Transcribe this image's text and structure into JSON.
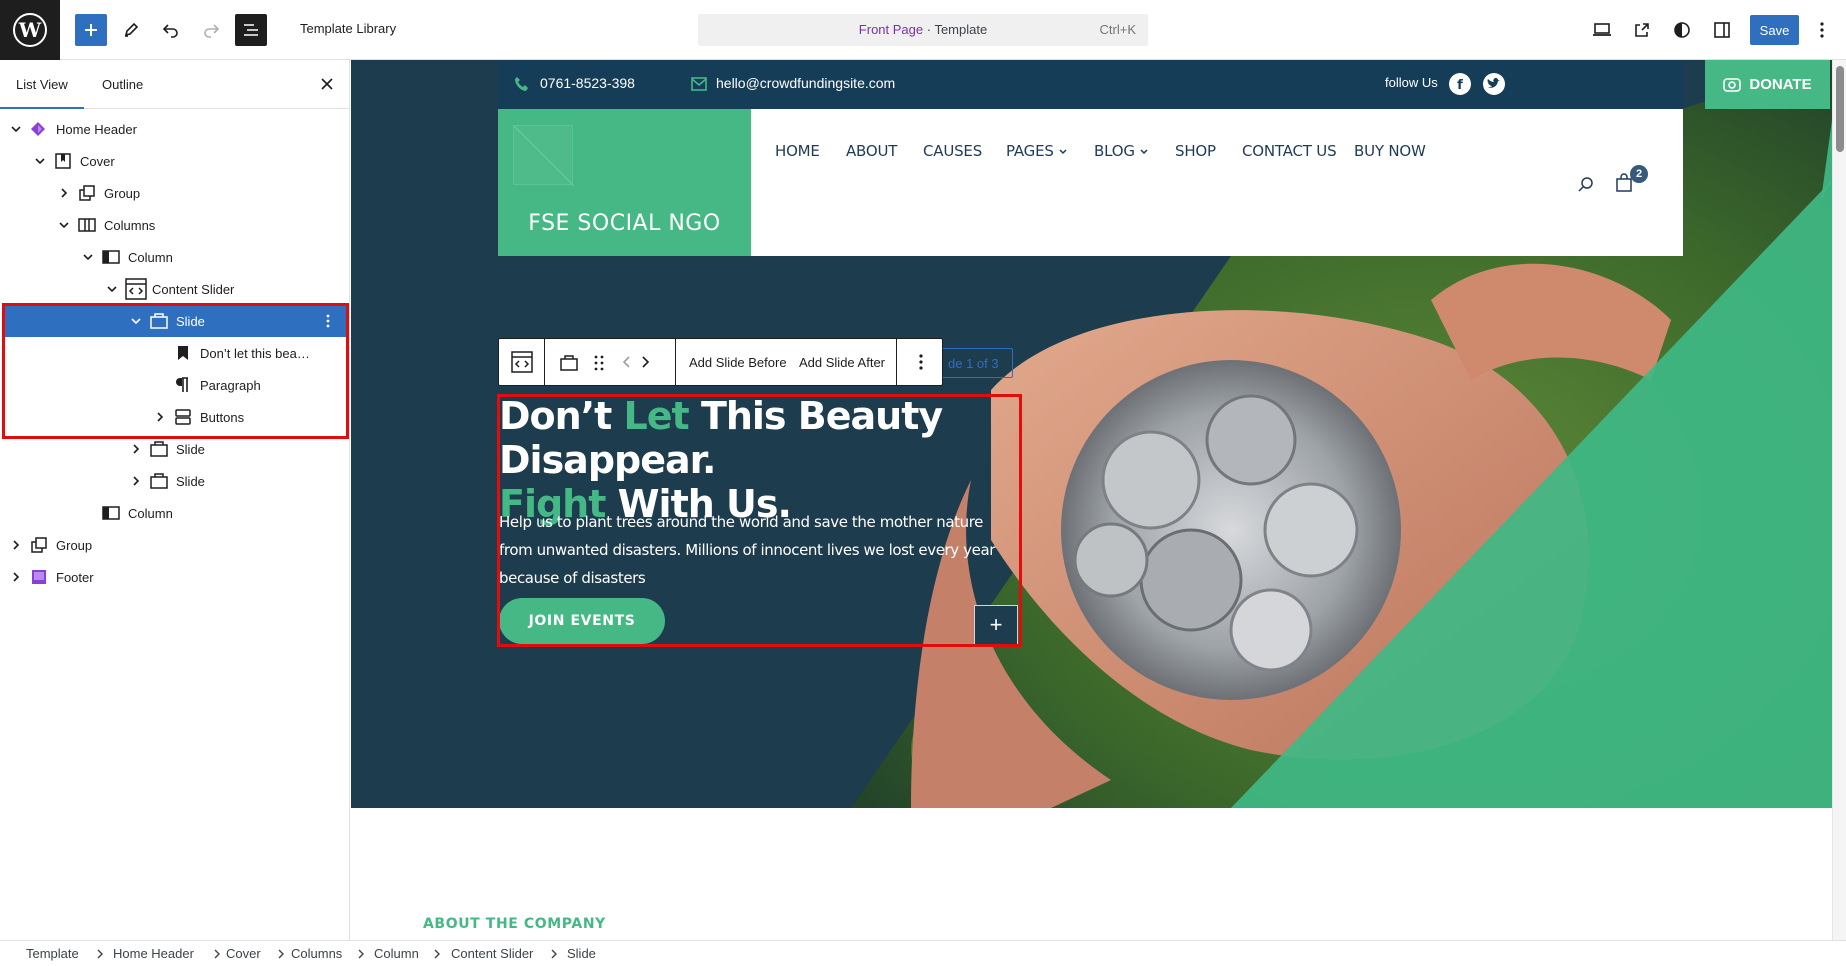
{
  "topbar": {
    "title": "Template Library",
    "command": {
      "page": "Front Page",
      "separator": " · ",
      "type": "Template",
      "shortcut": "Ctrl+K"
    },
    "save_label": "Save"
  },
  "panel": {
    "tabs": [
      "List View",
      "Outline"
    ],
    "tree": [
      {
        "label": "Home Header"
      },
      {
        "label": "Cover"
      },
      {
        "label": "Group"
      },
      {
        "label": "Columns"
      },
      {
        "label": "Column"
      },
      {
        "label": "Content Slider"
      },
      {
        "label": "Slide"
      },
      {
        "label": "Don’t let this bea…"
      },
      {
        "label": "Paragraph"
      },
      {
        "label": "Buttons"
      },
      {
        "label": "Slide"
      },
      {
        "label": "Slide"
      },
      {
        "label": "Column"
      },
      {
        "label": "Group"
      },
      {
        "label": "Footer"
      }
    ]
  },
  "site": {
    "phone": "0761-8523-398",
    "email": "hello@crowdfundingsite.com",
    "follow": "follow Us",
    "donate": "DONATE",
    "logo_name": "FSE SOCIAL NGO",
    "nav": [
      "HOME",
      "ABOUT",
      "CAUSES",
      "PAGES",
      "BLOG",
      "SHOP",
      "CONTACT US",
      "BUY NOW"
    ],
    "cart_count": "2"
  },
  "block_toolbar": {
    "add_before": "Add Slide Before",
    "add_after": "Add Slide After",
    "slide_count": "de 1 of 3",
    "slide_count_prefix": "S"
  },
  "slide": {
    "heading_1": "Don’t",
    "heading_green_1": "Let",
    "heading_2": "This Beauty Disappear.",
    "heading_green_2": "Fight",
    "heading_3": "With Us.",
    "paragraph": "Help us to plant trees around the world and save the mother nature from unwanted disasters. Millions of innocent lives we lost every year because of disasters",
    "button": "JOIN EVENTS",
    "plus": "+"
  },
  "section": {
    "about": "ABOUT THE COMPANY"
  },
  "breadcrumb": [
    "Template",
    "Home Header",
    "Cover",
    "Columns",
    "Column",
    "Content Slider",
    "Slide"
  ],
  "colors": {
    "accent": "#2f6fbf",
    "green": "#46b885",
    "navy": "#163d58",
    "highlight": "#e10d0d"
  }
}
